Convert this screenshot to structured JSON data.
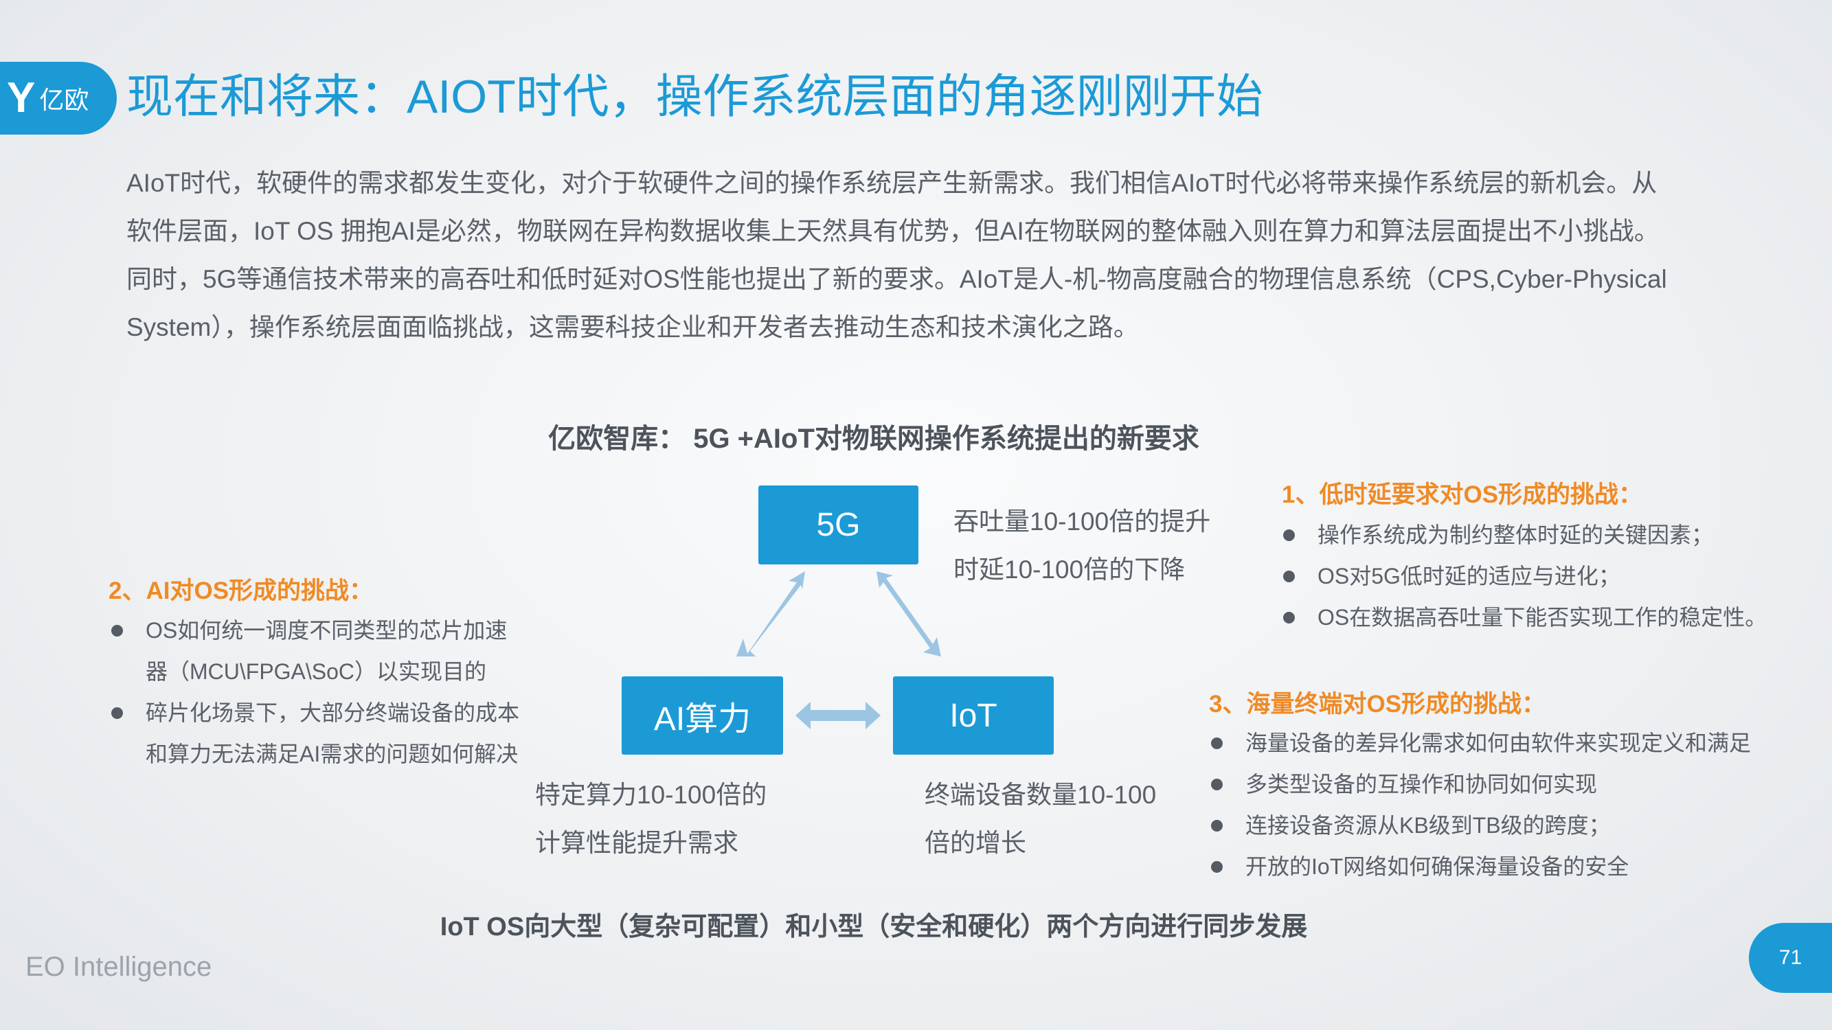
{
  "logo": {
    "text": "亿欧"
  },
  "title": "现在和将来：AIOT时代，操作系统层面的角逐刚刚开始",
  "paragraph": [
    "AIoT时代，软硬件的需求都发生变化，对介于软硬件之间的操作系统层产生新需求。我们相信AIoT时代必将带来操作系统层的新机会。从",
    "软件层面，IoT  OS  拥抱AI是必然，物联网在异构数据收集上天然具有优势，但AI在物联网的整体融入则在算力和算法层面提出不小挑战。",
    "同时，5G等通信技术带来的高吞吐和低时延对OS性能也提出了新的要求。AIoT是人-机-物高度融合的物理信息系统（CPS,Cyber-Physical",
    "System），操作系统层面面临挑战，这需要科技企业和开发者去推动生态和技术演化之路。"
  ],
  "diagram": {
    "title": "亿欧智库：  5G +AIoT对物联网操作系统提出的新要求",
    "nodes": {
      "fiveg": "5G",
      "ai": "AI算力",
      "iot": "IoT"
    },
    "fiveg_desc": [
      "吞吐量10-100倍的提升",
      "时延10-100倍的下降"
    ],
    "ai_desc": [
      "特定算力10-100倍的",
      "计算性能提升需求"
    ],
    "iot_desc": [
      "终端设备数量10-100",
      "倍的增长"
    ],
    "arrow_color": "#9cc5e3"
  },
  "sections": [
    {
      "heading": "1、低时延要求对OS形成的挑战：",
      "bullets": [
        "操作系统成为制约整体时延的关键因素；",
        "OS对5G低时延的适应与进化；",
        "OS在数据高吞吐量下能否实现工作的稳定性。"
      ]
    },
    {
      "heading": "2、AI对OS形成的挑战：",
      "bullets": [
        [
          "OS如何统一调度不同类型的芯片加速",
          "器（MCU\\FPGA\\SoC）以实现目的"
        ],
        [
          "碎片化场景下，大部分终端设备的成本",
          "和算力无法满足AI需求的问题如何解决"
        ]
      ]
    },
    {
      "heading": "3、海量终端对OS形成的挑战：",
      "bullets": [
        "海量设备的差异化需求如何由软件来实现定义和满足",
        "多类型设备的互操作和协同如何实现",
        "连接设备资源从KB级到TB级的跨度；",
        "开放的IoT网络如何确保海量设备的安全"
      ]
    }
  ],
  "bottom": "IoT OS向大型（复杂可配置）和小型（安全和硬化）两个方向进行同步发展",
  "footer": "EO Intelligence",
  "page_number": "71",
  "colors": {
    "brand": "#1b9ad6",
    "accent": "#f08a24"
  }
}
